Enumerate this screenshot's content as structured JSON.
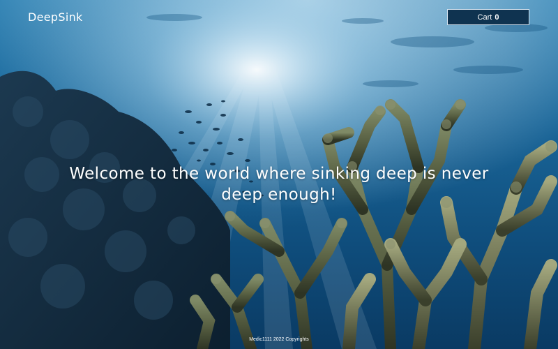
{
  "header": {
    "brand": "DeepSink",
    "cart_label": "Cart",
    "cart_count": "0"
  },
  "hero": {
    "headline": "Welcome to the world where sinking deep is never deep enough!"
  },
  "footer": {
    "copyright": "Medic1111 2022 Copyrights"
  },
  "colors": {
    "ocean_top": "#1f6a9c",
    "ocean_deep": "#0b3a5e",
    "cart_bg": "#0f3350",
    "text": "#ffffff"
  }
}
